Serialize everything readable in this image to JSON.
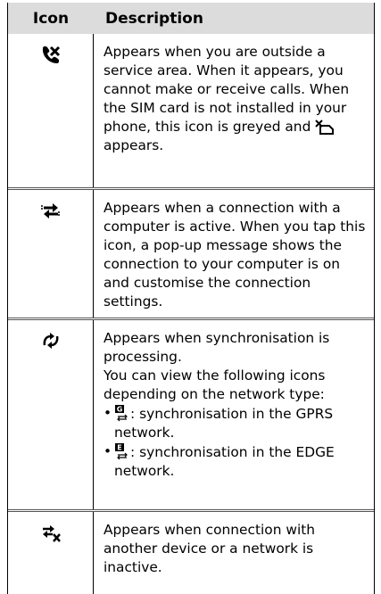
{
  "table": {
    "headers": {
      "icon": "Icon",
      "description": "Description"
    },
    "rows": [
      {
        "icon": "no-service-icon",
        "text_before": "Appears when you are outside a service area. When it appears, you cannot make or receive calls. When the SIM card is not installed in your phone, this icon is greyed and",
        "inline_icon": "no-sim-icon",
        "text_after": "appears."
      },
      {
        "icon": "activesync-connection-icon",
        "text": "Appears when a connection with a computer is active. When you tap this icon, a pop-up message shows the connection to your computer is on and customise the connection settings."
      },
      {
        "icon": "synchronisation-icon",
        "line1": "Appears when synchronisation is processing.",
        "line2": "You can view the following icons depending on the network type:",
        "bullets": [
          {
            "icon": "gprs-sync-icon",
            "icon_letter": "G",
            "text": ": synchronisation in the GPRS network."
          },
          {
            "icon": "edge-sync-icon",
            "icon_letter": "E",
            "text": ": synchronisation in the EDGE network."
          }
        ]
      },
      {
        "icon": "connection-inactive-icon",
        "text": "Appears when connection with another device or a network is inactive."
      }
    ]
  }
}
